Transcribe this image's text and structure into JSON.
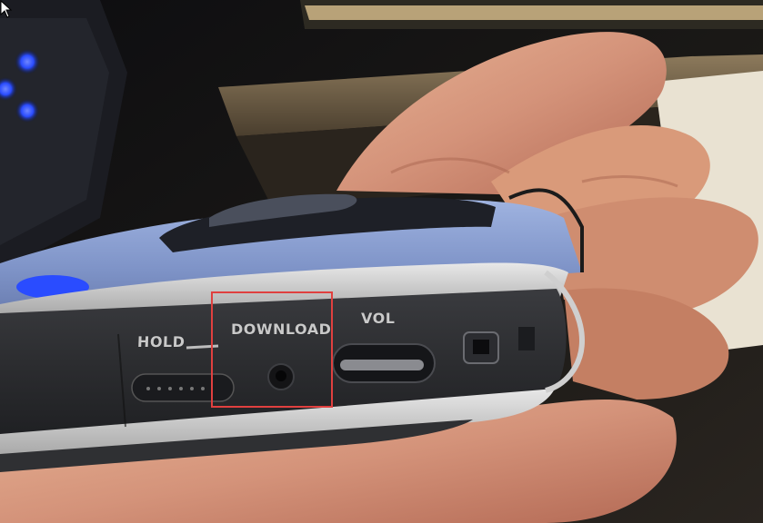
{
  "scene": {
    "device_labels": {
      "hold": "HOLD",
      "download": "DOWNLOAD",
      "vol": "VOL"
    },
    "highlight": {
      "target": "download-button",
      "color": "#e0403f"
    },
    "colors": {
      "device_body": "#8aa0d4",
      "device_band": "#2a2b2e",
      "skin": "#d99a7a",
      "background": "#151515",
      "led": "#2a4cff"
    }
  }
}
